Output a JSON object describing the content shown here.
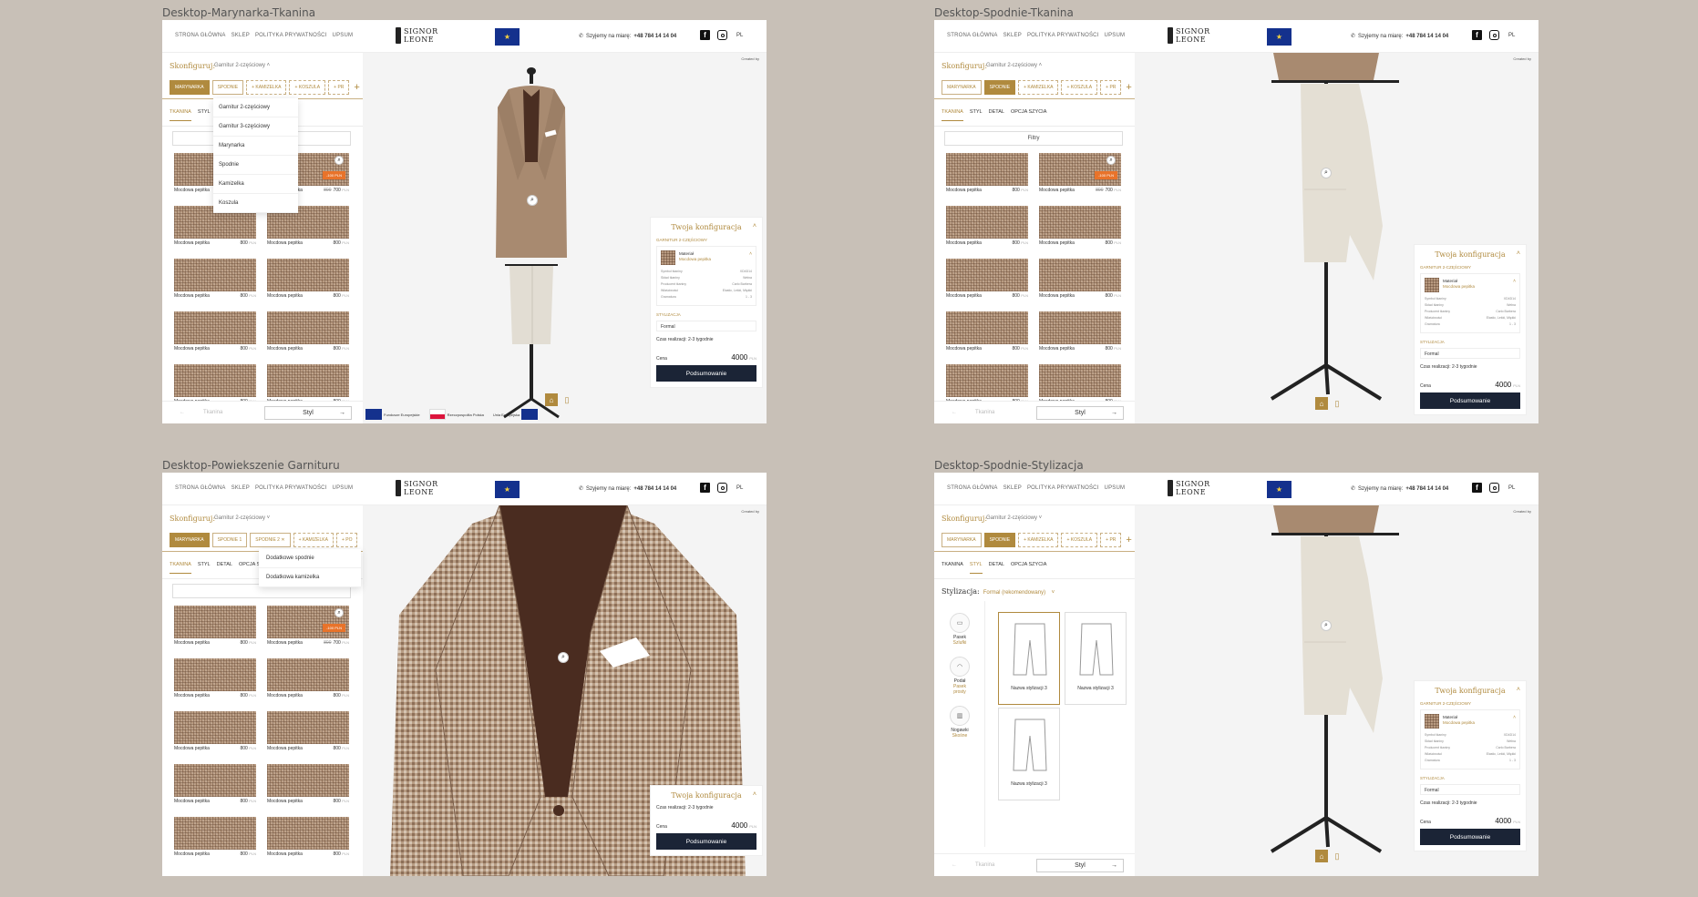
{
  "frames": [
    {
      "label": "Desktop-Marynarka-Tkanina"
    },
    {
      "label": "Desktop-Spodnie-Tkanina"
    },
    {
      "label": "Desktop-Powiekszenie Garnituru"
    },
    {
      "label": "Desktop-Spodnie-Stylizacja"
    }
  ],
  "header": {
    "nav": [
      "STRONA GŁÓWNA",
      "SKLEP",
      "POLITYKA PRYWATNOŚCI",
      "UPSUM"
    ],
    "logo_line1": "SIGNOR",
    "logo_line2": "LEONE",
    "phone_label": "Szyjemy na miarę:",
    "phone_number": "+48 784 14 14 04",
    "lang": "PL"
  },
  "config": {
    "label": "Skonfiguruj:",
    "selected": "Garnitur 2-częściowy",
    "chips_a": [
      "MARYNARKA",
      "SPODNIE",
      "+ KAMIZELKA",
      "+ KOSZULA",
      "+ PR"
    ],
    "chips_b": [
      "MARYNARKA",
      "SPODNIE 1",
      "SPODNIE 2",
      "+ KAMIZELKA",
      "+ PO"
    ],
    "tabs": [
      "TKANINA",
      "STYL",
      "DETAL",
      "OPCJA SZYCIA"
    ],
    "filter": "Filtry",
    "dropdown": [
      "Garnitur 2-częściowy",
      "Garnitur 3-częściowy",
      "Marynarka",
      "Spodnie",
      "Kamizelka",
      "Koszula"
    ],
    "dropdown2": [
      "Dodatkowe spodnie",
      "Dodatkowa kamizelka"
    ]
  },
  "fabric": {
    "name": "Mocdowa pepitka",
    "price": "800",
    "old_price": "800",
    "new_price": "700",
    "unit": "PLN",
    "sale": "-100 PLN"
  },
  "bottom": {
    "prev": "Tkanina",
    "next": "Styl"
  },
  "summary": {
    "title": "Twoja konfiguracja",
    "section": "GARNITUR 2-CZĘŚCIOWY",
    "material": "Materiał",
    "material_name": "Mocdowa pepitka",
    "rows": [
      [
        "Symbol tkaniny",
        "XD4D14"
      ],
      [
        "Skład tkaniny",
        "Wełna"
      ],
      [
        "Producent tkaniny",
        "Carlo Barbera"
      ],
      [
        "Właściwości",
        "Elastic, Lekki, Miękki"
      ],
      [
        "Gramatura",
        "1 - 3"
      ]
    ],
    "styl_label": "STYLIZACJA",
    "styl_value": "Formal",
    "realiz": "Czas realizacji: 2-3 tygodnie",
    "price_label": "Cena",
    "price": "4000",
    "unit": "PLN",
    "button": "Podsumowanie"
  },
  "created": "Created by",
  "funding": [
    "Fundusze Europejskie",
    "Rzeczpospolita Polska",
    "Unia Europejska"
  ],
  "stylizacja": {
    "label": "Stylizacja:",
    "value": "Formal (rekomendowany)",
    "options": [
      {
        "name": "Pasek",
        "sub": "Szlufki"
      },
      {
        "name": "Podał",
        "sub": "Pasek prosty"
      },
      {
        "name": "Nogawki",
        "sub": "Skośne"
      }
    ],
    "cards": [
      "Nazwa stylizacji 3",
      "Nazwa stylizacji 3",
      "Nazwa stylizacji 3"
    ]
  }
}
